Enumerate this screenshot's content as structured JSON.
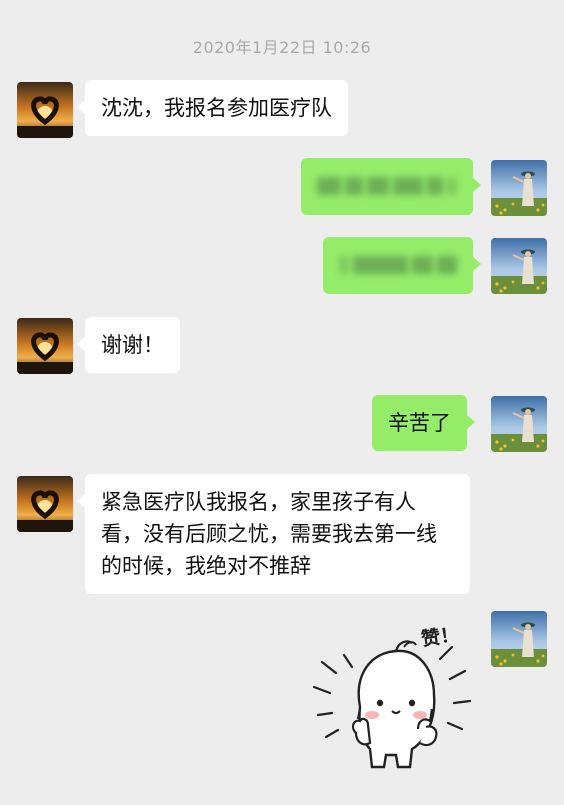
{
  "chat": {
    "timestamp": "2020年1月22日 10:26",
    "messages": [
      {
        "side": "in",
        "text": "沈沈，我报名参加医疗队"
      },
      {
        "side": "out",
        "text": "",
        "blurred": true
      },
      {
        "side": "out",
        "text": "",
        "blurred": true
      },
      {
        "side": "in",
        "text": "谢谢！"
      },
      {
        "side": "out",
        "text": "辛苦了"
      },
      {
        "side": "in",
        "text": "紧急医疗队我报名，家里孩子有人看，没有后顾之忧，需要我去第一线的时候，我绝对不推辞"
      },
      {
        "side": "out",
        "sticker": "thumbs-up-sticker",
        "sticker_text": "赞！"
      }
    ]
  },
  "avatars": {
    "contact": "heart-hands-sunset-avatar",
    "self": "woman-in-field-avatar"
  },
  "colors": {
    "background": "#ededed",
    "incoming_bubble": "#ffffff",
    "outgoing_bubble": "#95ec69",
    "timestamp": "#a9a9a9"
  }
}
